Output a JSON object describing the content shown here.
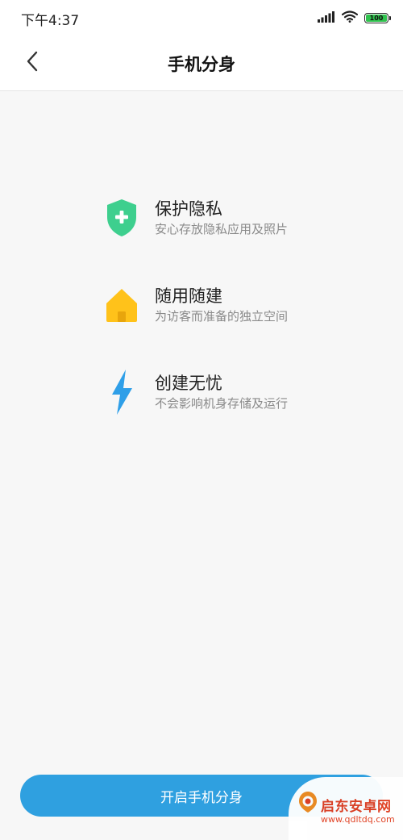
{
  "status_bar": {
    "time": "下午4:37",
    "battery_level": 100,
    "battery_text": "100",
    "battery_color": "#2fc24d"
  },
  "header": {
    "title": "手机分身",
    "back_icon": "chevron-left-icon"
  },
  "features": [
    {
      "icon": "shield-plus-icon",
      "icon_color": "#3ecf8e",
      "title": "保护隐私",
      "description": "安心存放隐私应用及照片"
    },
    {
      "icon": "house-icon",
      "icon_color": "#ffc21a",
      "title": "随用随建",
      "description": "为访客而准备的独立空间"
    },
    {
      "icon": "lightning-icon",
      "icon_color": "#2f9fe8",
      "title": "创建无忧",
      "description": "不会影响机身存储及运行"
    }
  ],
  "primary_button": {
    "label": "开启手机分身",
    "color": "#2fa0e0"
  },
  "watermark": {
    "name": "启东安卓网",
    "url": "www.qdltdq.com",
    "color": "#e03c1e"
  }
}
